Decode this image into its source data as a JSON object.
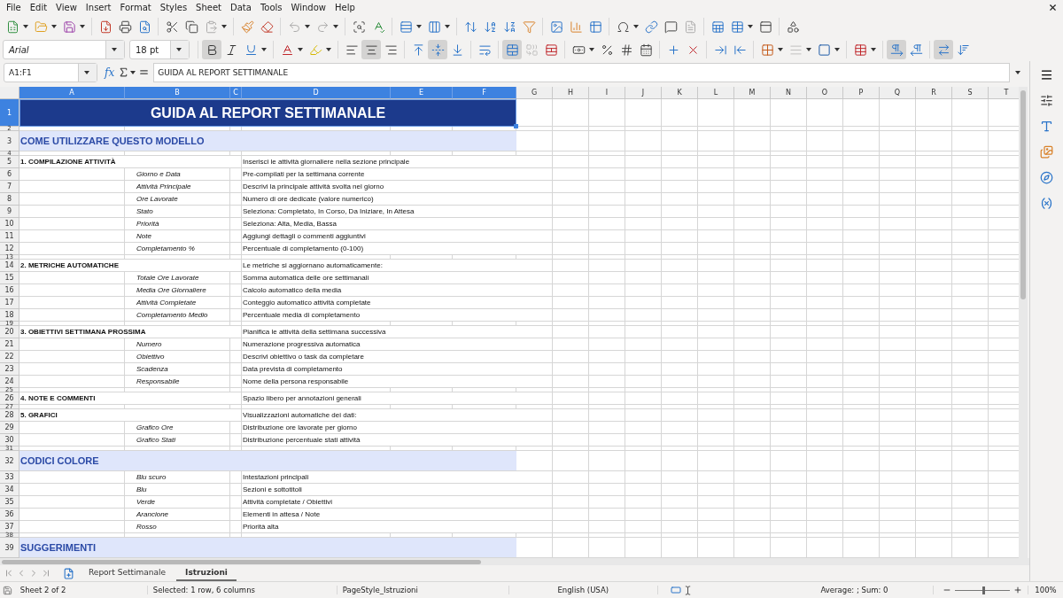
{
  "menu": [
    "File",
    "Edit",
    "View",
    "Insert",
    "Format",
    "Styles",
    "Sheet",
    "Data",
    "Tools",
    "Window",
    "Help"
  ],
  "standard_toolbar": [
    {
      "disabled": false
    },
    {
      "disabled": false
    },
    {
      "disabled": false
    },
    {
      "disabled": false
    },
    {
      "disabled": false
    },
    {
      "disabled": false
    },
    {
      "disabled": false
    },
    {
      "disabled": false
    },
    {
      "disabled": true
    },
    {
      "disabled": false
    },
    {
      "disabled": false
    },
    {
      "disabled": true
    },
    {
      "disabled": true
    },
    {
      "disabled": false
    },
    {
      "disabled": false
    },
    {
      "disabled": false
    },
    {
      "disabled": false
    },
    {
      "disabled": false
    },
    {
      "disabled": false
    },
    {
      "disabled": false
    },
    {
      "disabled": false
    },
    {
      "disabled": false
    },
    {
      "disabled": false
    },
    {
      "disabled": false
    },
    {
      "disabled": false
    },
    {
      "disabled": false
    },
    {
      "disabled": false
    },
    {
      "disabled": true
    },
    {
      "disabled": false
    },
    {
      "disabled": false
    },
    {
      "disabled": false
    },
    {
      "disabled": false
    }
  ],
  "formatting_toolbar": {
    "font_name": "Arial",
    "font_size": "18 pt",
    "buttons": [
      {
        "on": true,
        "disabled": false
      },
      {
        "on": false,
        "disabled": false
      },
      {
        "on": false,
        "disabled": false
      },
      {
        "on": false,
        "disabled": false
      },
      {
        "on": false,
        "disabled": false
      },
      {
        "on": false,
        "disabled": false
      },
      {
        "on": true,
        "disabled": false
      },
      {
        "on": false,
        "disabled": false
      },
      {
        "on": false,
        "disabled": false
      },
      {
        "on": true,
        "disabled": false
      },
      {
        "on": false,
        "disabled": false
      },
      {
        "on": false,
        "disabled": false
      },
      {
        "on": true,
        "disabled": false
      },
      {
        "on": false,
        "disabled": true
      },
      {
        "on": false,
        "disabled": false
      },
      {
        "on": false,
        "disabled": false
      },
      {
        "on": false,
        "disabled": false
      },
      {
        "on": false,
        "disabled": false
      },
      {
        "on": false,
        "disabled": false
      },
      {
        "on": false,
        "disabled": false
      },
      {
        "on": false,
        "disabled": false
      },
      {
        "on": false,
        "disabled": false
      },
      {
        "on": false,
        "disabled": false
      },
      {
        "on": false,
        "disabled": false
      },
      {
        "on": false,
        "disabled": true
      },
      {
        "on": false,
        "disabled": false
      },
      {
        "on": false,
        "disabled": false
      },
      {
        "on": true,
        "disabled": false
      },
      {
        "on": false,
        "disabled": false
      },
      {
        "on": true,
        "disabled": false
      },
      {
        "on": false,
        "disabled": false
      }
    ]
  },
  "formula_bar": {
    "name_box": "A1:F1",
    "function_label": "fx",
    "content": "GUIDA AL REPORT SETTIMANALE"
  },
  "columns": [
    {
      "label": "A",
      "selected": true
    },
    {
      "label": "B",
      "selected": true
    },
    {
      "label": "C",
      "selected": true
    },
    {
      "label": "D",
      "selected": true
    },
    {
      "label": "E",
      "selected": true
    },
    {
      "label": "F",
      "selected": true
    },
    {
      "label": "G",
      "selected": false
    },
    {
      "label": "H",
      "selected": false
    },
    {
      "label": "I",
      "selected": false
    },
    {
      "label": "J",
      "selected": false
    },
    {
      "label": "K",
      "selected": false
    },
    {
      "label": "L",
      "selected": false
    },
    {
      "label": "M",
      "selected": false
    },
    {
      "label": "N",
      "selected": false
    },
    {
      "label": "O",
      "selected": false
    },
    {
      "label": "P",
      "selected": false
    },
    {
      "label": "Q",
      "selected": false
    },
    {
      "label": "R",
      "selected": false
    },
    {
      "label": "S",
      "selected": false
    },
    {
      "label": "T",
      "selected": false
    }
  ],
  "rows": [
    {
      "number": "1",
      "kind": "title",
      "selected": true,
      "a": "GUIDA AL REPORT SETTIMANALE"
    },
    {
      "number": "2",
      "kind": "spacer",
      "selected": false
    },
    {
      "number": "3",
      "kind": "section",
      "selected": false,
      "a": "COME UTILIZZARE QUESTO MODELLO"
    },
    {
      "number": "4",
      "kind": "spacer",
      "selected": false
    },
    {
      "number": "5",
      "kind": "heading",
      "selected": false,
      "a": "1. COMPILAZIONE ATTIVITÀ",
      "d": "Inserisci le attività giornaliere nella sezione principale"
    },
    {
      "number": "6",
      "kind": "item",
      "selected": false,
      "b": "Giorno e Data",
      "d": "Pre-compilati per la settimana corrente"
    },
    {
      "number": "7",
      "kind": "item",
      "selected": false,
      "b": "Attività Principale",
      "d": "Descrivi la principale attività svolta nel giorno"
    },
    {
      "number": "8",
      "kind": "item",
      "selected": false,
      "b": "Ore Lavorate",
      "d": "Numero di ore dedicate (valore numerico)"
    },
    {
      "number": "9",
      "kind": "item",
      "selected": false,
      "b": "Stato",
      "d": "Seleziona: Completato, In Corso, Da Iniziare, In Attesa"
    },
    {
      "number": "10",
      "kind": "item",
      "selected": false,
      "b": "Priorità",
      "d": "Seleziona: Alta, Media, Bassa"
    },
    {
      "number": "11",
      "kind": "item",
      "selected": false,
      "b": "Note",
      "d": "Aggiungi dettagli o commenti aggiuntivi"
    },
    {
      "number": "12",
      "kind": "item",
      "selected": false,
      "b": "Completamento %",
      "d": "Percentuale di completamento (0-100)"
    },
    {
      "number": "13",
      "kind": "spacer",
      "selected": false
    },
    {
      "number": "14",
      "kind": "heading",
      "selected": false,
      "a": "2. METRICHE AUTOMATICHE",
      "d": "Le metriche si aggiornano automaticamente:"
    },
    {
      "number": "15",
      "kind": "item",
      "selected": false,
      "b": "Totale Ore Lavorate",
      "d": "Somma automatica delle ore settimanali"
    },
    {
      "number": "16",
      "kind": "item",
      "selected": false,
      "b": "Media Ore Giornaliere",
      "d": "Calcolo automatico della media"
    },
    {
      "number": "17",
      "kind": "item",
      "selected": false,
      "b": "Attività Completate",
      "d": "Conteggio automatico attività completate"
    },
    {
      "number": "18",
      "kind": "item",
      "selected": false,
      "b": "Completamento Medio",
      "d": "Percentuale media di completamento"
    },
    {
      "number": "19",
      "kind": "spacer",
      "selected": false
    },
    {
      "number": "20",
      "kind": "heading",
      "selected": false,
      "a": "3. OBIETTIVI SETTIMANA PROSSIMA",
      "d": "Pianifica le attività della settimana successiva"
    },
    {
      "number": "21",
      "kind": "item",
      "selected": false,
      "b": "Numero",
      "d": "Numerazione progressiva automatica"
    },
    {
      "number": "22",
      "kind": "item",
      "selected": false,
      "b": "Obiettivo",
      "d": "Descrivi obiettivo o task da completare"
    },
    {
      "number": "23",
      "kind": "item",
      "selected": false,
      "b": "Scadenza",
      "d": "Data prevista di completamento"
    },
    {
      "number": "24",
      "kind": "item",
      "selected": false,
      "b": "Responsabile",
      "d": "Nome della persona responsabile"
    },
    {
      "number": "25",
      "kind": "spacer",
      "selected": false
    },
    {
      "number": "26",
      "kind": "heading",
      "selected": false,
      "a": "4. NOTE E COMMENTI",
      "d": "Spazio libero per annotazioni generali"
    },
    {
      "number": "27",
      "kind": "spacer",
      "selected": false
    },
    {
      "number": "28",
      "kind": "heading",
      "selected": false,
      "a": "5. GRAFICI",
      "d": "Visualizzazioni automatiche dei dati:"
    },
    {
      "number": "29",
      "kind": "item",
      "selected": false,
      "b": "Grafico Ore",
      "d": "Distribuzione ore lavorate per giorno"
    },
    {
      "number": "30",
      "kind": "item",
      "selected": false,
      "b": "Grafico Stati",
      "d": "Distribuzione percentuale stati attività"
    },
    {
      "number": "31",
      "kind": "spacer",
      "selected": false
    },
    {
      "number": "32",
      "kind": "section",
      "selected": false,
      "a": "CODICI COLORE"
    },
    {
      "number": "33",
      "kind": "item",
      "selected": false,
      "b": "Blu scuro",
      "d": "Intestazioni principali"
    },
    {
      "number": "34",
      "kind": "item",
      "selected": false,
      "b": "Blu",
      "d": "Sezioni e sottotitoli"
    },
    {
      "number": "35",
      "kind": "item",
      "selected": false,
      "b": "Verde",
      "d": "Attività completate / Obiettivi"
    },
    {
      "number": "36",
      "kind": "item",
      "selected": false,
      "b": "Arancione",
      "d": "Elementi in attesa / Note"
    },
    {
      "number": "37",
      "kind": "item",
      "selected": false,
      "b": "Rosso",
      "d": "Priorità alta"
    },
    {
      "number": "38",
      "kind": "spacer",
      "selected": false
    },
    {
      "number": "39",
      "kind": "section",
      "selected": false,
      "a": "SUGGERIMENTI"
    }
  ],
  "sheet_tabs": [
    {
      "label": "Report Settimanale",
      "selected": false
    },
    {
      "label": "Istruzioni",
      "selected": true
    }
  ],
  "status_bar": {
    "sheet": "Sheet 2 of 2",
    "selection": "Selected: 1 row, 6 columns",
    "page_style": "PageStyle_Istruzioni",
    "language": "English (USA)",
    "sum": "Average: ; Sum: 0",
    "zoom_slider": {
      "level": 0.5
    },
    "zoom": "100%"
  }
}
